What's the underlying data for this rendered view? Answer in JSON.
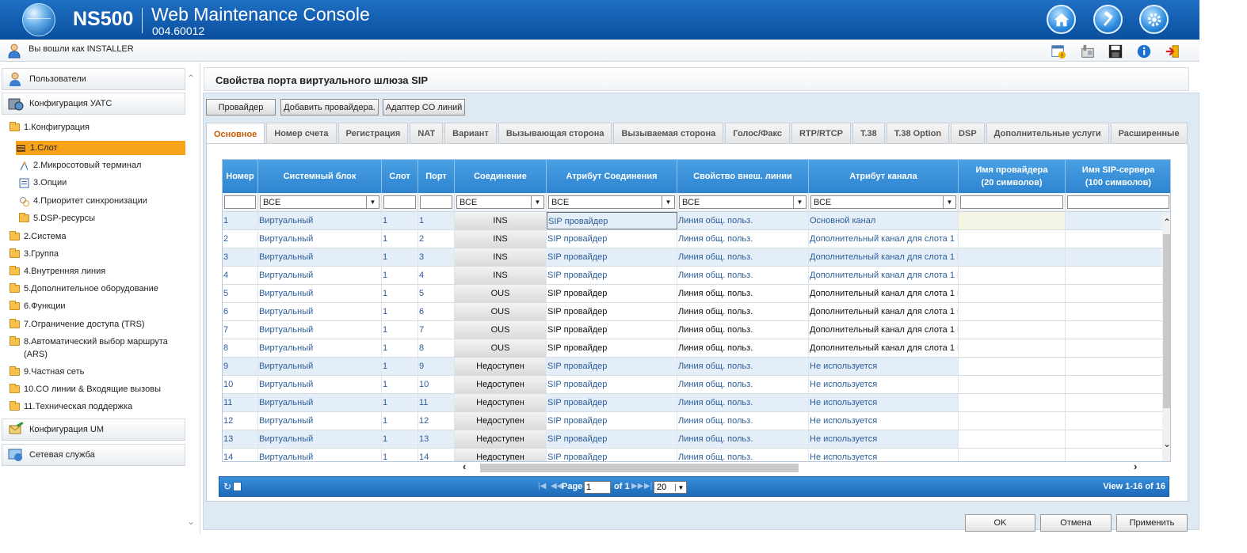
{
  "header": {
    "model": "NS500",
    "title": "Web Maintenance Console",
    "version": "004.60012"
  },
  "userbar": {
    "login_text": "Вы вошли как INSTALLER"
  },
  "sidebar": {
    "sections": [
      "Пользователи",
      "Конфигурация УАТС",
      "Конфигурация UM",
      "Сетевая служба"
    ],
    "tree": [
      {
        "label": "1.Конфигурация"
      },
      {
        "label": "1.Слот"
      },
      {
        "label": "2.Микросотовый терминал"
      },
      {
        "label": "3.Опции"
      },
      {
        "label": "4.Приоритет синхронизации"
      },
      {
        "label": "5.DSP-ресурсы"
      },
      {
        "label": "2.Система"
      },
      {
        "label": "3.Группа"
      },
      {
        "label": "4.Внутренняя линия"
      },
      {
        "label": "5.Дополнительное оборудование"
      },
      {
        "label": "6.Функции"
      },
      {
        "label": "7.Ограничение доступа (TRS)"
      },
      {
        "label": "8.Автоматический выбор маршрута"
      },
      {
        "label": "(ARS)"
      },
      {
        "label": "9.Частная сеть"
      },
      {
        "label": "10.CO линии & Входящие вызовы"
      },
      {
        "label": "11.Техническая поддержка"
      }
    ]
  },
  "main": {
    "title": "Свойства порта виртуального шлюза SIP",
    "buttons": [
      "Провайдер",
      "Добавить провайдера.",
      "Адаптер CO линий"
    ],
    "tabs": [
      "Основное",
      "Номер счета",
      "Регистрация",
      "NAT",
      "Вариант",
      "Вызывающая сторона",
      "Вызываемая сторона",
      "Голос/Факс",
      "RTP/RTCP",
      "T.38",
      "T.38 Option",
      "DSP",
      "Дополнительные услуги",
      "Расширенные"
    ],
    "active_tab": "Основное"
  },
  "grid": {
    "headers": {
      "num": "Номер",
      "sys": "Системный блок",
      "slot": "Слот",
      "port": "Порт",
      "conn": "Соединение",
      "attr": "Атрибут Соединения",
      "prop": "Свойство внеш. линии",
      "chan": "Атрибут канала",
      "prov1": "Имя провайдера",
      "prov2": "(20 символов)",
      "srv1": "Имя SIP-сервера",
      "srv2": "(100 символов)"
    },
    "filter_all": "ВСЕ",
    "rows": [
      {
        "num": "1",
        "sys": "Виртуальный",
        "slot": "1",
        "port": "1",
        "conn": "INS",
        "attr": "SIP провайдер",
        "prop": "Линия общ. польз.",
        "chan": "Основной канал"
      },
      {
        "num": "2",
        "sys": "Виртуальный",
        "slot": "1",
        "port": "2",
        "conn": "INS",
        "attr": "SIP провайдер",
        "prop": "Линия общ. польз.",
        "chan": "Дополнительный канал для слота 1 К"
      },
      {
        "num": "3",
        "sys": "Виртуальный",
        "slot": "1",
        "port": "3",
        "conn": "INS",
        "attr": "SIP провайдер",
        "prop": "Линия общ. польз.",
        "chan": "Дополнительный канал для слота 1 К"
      },
      {
        "num": "4",
        "sys": "Виртуальный",
        "slot": "1",
        "port": "4",
        "conn": "INS",
        "attr": "SIP провайдер",
        "prop": "Линия общ. польз.",
        "chan": "Дополнительный канал для слота 1 К"
      },
      {
        "num": "5",
        "sys": "Виртуальный",
        "slot": "1",
        "port": "5",
        "conn": "OUS",
        "attr": "SIP провайдер",
        "prop": "Линия общ. польз.",
        "chan": "Дополнительный канал для слота 1 К"
      },
      {
        "num": "6",
        "sys": "Виртуальный",
        "slot": "1",
        "port": "6",
        "conn": "OUS",
        "attr": "SIP провайдер",
        "prop": "Линия общ. польз.",
        "chan": "Дополнительный канал для слота 1 К"
      },
      {
        "num": "7",
        "sys": "Виртуальный",
        "slot": "1",
        "port": "7",
        "conn": "OUS",
        "attr": "SIP провайдер",
        "prop": "Линия общ. польз.",
        "chan": "Дополнительный канал для слота 1 К"
      },
      {
        "num": "8",
        "sys": "Виртуальный",
        "slot": "1",
        "port": "8",
        "conn": "OUS",
        "attr": "SIP провайдер",
        "prop": "Линия общ. польз.",
        "chan": "Дополнительный канал для слота 1 К"
      },
      {
        "num": "9",
        "sys": "Виртуальный",
        "slot": "1",
        "port": "9",
        "conn": "Недоступен",
        "attr": "SIP провайдер",
        "prop": "Линия общ. польз.",
        "chan": "Не используется"
      },
      {
        "num": "10",
        "sys": "Виртуальный",
        "slot": "1",
        "port": "10",
        "conn": "Недоступен",
        "attr": "SIP провайдер",
        "prop": "Линия общ. польз.",
        "chan": "Не используется"
      },
      {
        "num": "11",
        "sys": "Виртуальный",
        "slot": "1",
        "port": "11",
        "conn": "Недоступен",
        "attr": "SIP провайдер",
        "prop": "Линия общ. польз.",
        "chan": "Не используется"
      },
      {
        "num": "12",
        "sys": "Виртуальный",
        "slot": "1",
        "port": "12",
        "conn": "Недоступен",
        "attr": "SIP провайдер",
        "prop": "Линия общ. польз.",
        "chan": "Не используется"
      },
      {
        "num": "13",
        "sys": "Виртуальный",
        "slot": "1",
        "port": "13",
        "conn": "Недоступен",
        "attr": "SIP провайдер",
        "prop": "Линия общ. польз.",
        "chan": "Не используется"
      },
      {
        "num": "14",
        "sys": "Виртуальный",
        "slot": "1",
        "port": "14",
        "conn": "Недоступен",
        "attr": "SIP провайдер",
        "prop": "Линия общ. польз.",
        "chan": "Не используется"
      }
    ]
  },
  "pager": {
    "page_label": "Page",
    "page_value": "1",
    "of_label": "of 1",
    "per_page": "20",
    "view_text": "View 1-16 of 16"
  },
  "footer": {
    "ok": "OK",
    "cancel": "Отмена",
    "apply": "Применить"
  }
}
